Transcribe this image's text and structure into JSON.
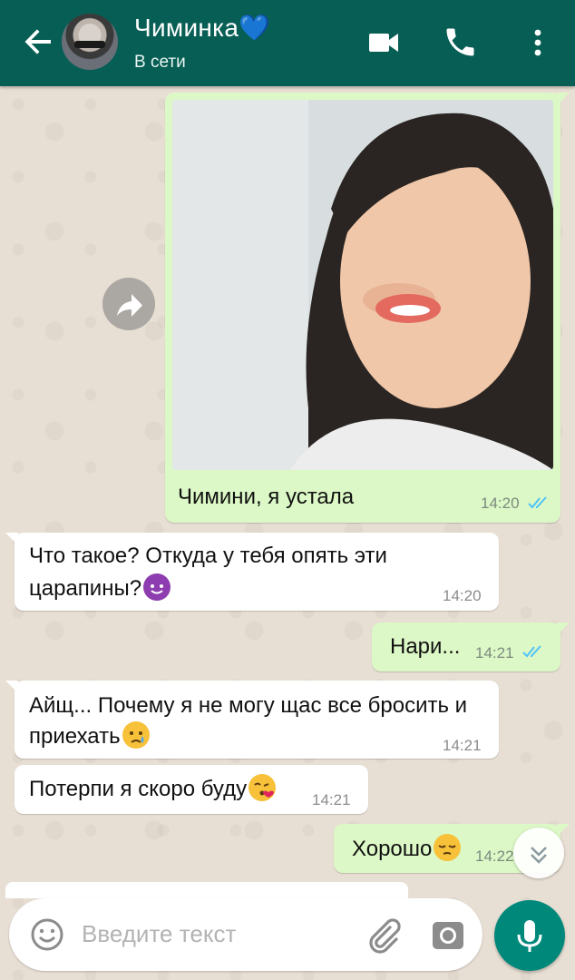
{
  "header": {
    "contact_name": "Чиминка💙",
    "status": "В сети",
    "icons": [
      "back-arrow-icon",
      "video-call-icon",
      "phone-call-icon",
      "more-vert-icon"
    ]
  },
  "messages": [
    {
      "direction": "out",
      "type": "image",
      "caption": "Чимини, я устала",
      "time": "14:20",
      "status": "read"
    },
    {
      "direction": "in",
      "text_line1": "Что такое? Откуда у тебя опять эти",
      "text_line2": "царапины?",
      "emoji": "smiling-devil",
      "time": "14:20"
    },
    {
      "direction": "out",
      "text": "Нари...",
      "time": "14:21",
      "status": "read"
    },
    {
      "direction": "in",
      "text_line1": "Айщ... Почему я не могу щас все бросить и",
      "text_line2": "приехать",
      "emoji": "crying-face",
      "time": "14:21"
    },
    {
      "direction": "in",
      "text": "Потерпи я скоро буду",
      "emoji": "face-blowing-kiss",
      "time": "14:21"
    },
    {
      "direction": "out",
      "text": "Хорошо",
      "emoji": "pensive-face",
      "time": "14:22",
      "status": "read"
    }
  ],
  "composer": {
    "placeholder": "Введите текст",
    "icons": [
      "emoji-icon",
      "attach-icon",
      "camera-icon",
      "mic-icon"
    ]
  },
  "colors": {
    "header": "#075e54",
    "outgoing_bubble": "#dcf8c6",
    "incoming_bubble": "#ffffff",
    "read_ticks": "#4fc3f7",
    "mic_button": "#00897b"
  }
}
